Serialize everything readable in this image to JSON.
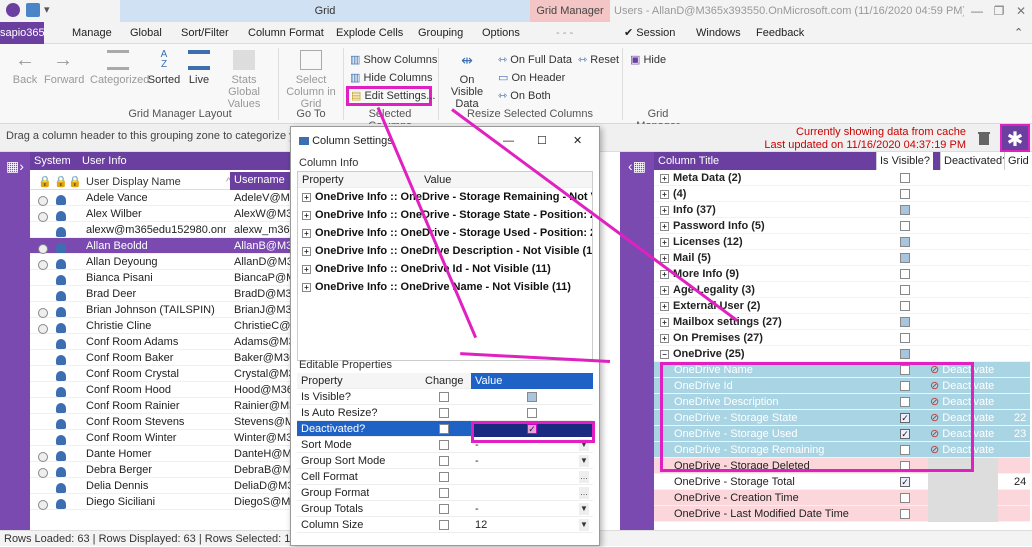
{
  "window": {
    "grid_title": "Grid",
    "gm_title": "Grid Manager",
    "title": "Users - AllanD@M365x393550.OnMicrosoft.com (11/16/2020 04:59 PM) - Adv...",
    "min": "—",
    "restore": "❐",
    "close": "✕"
  },
  "menu": {
    "app": "sapio365",
    "items": [
      "Manage",
      "Global",
      "Sort/Filter",
      "Column Format",
      "Explode Cells",
      "Grouping",
      "Options",
      "- - -",
      "Session",
      "Windows",
      "Feedback"
    ]
  },
  "ribbon": {
    "back": "Back",
    "forward": "Forward",
    "categorized": "Categorized",
    "sorted": "Sorted",
    "live": "Live",
    "stats": "Stats Global Values",
    "group_layout": "Grid Manager Layout",
    "select_col": "Select Column in Grid",
    "goto": "Go To",
    "show_cols": "Show Columns",
    "hide_cols": "Hide Columns",
    "edit_settings": "Edit Settings...",
    "group_selected": "Selected Columns",
    "on_visible": "On Visible Data",
    "on_full": "On Full Data",
    "on_header": "On Header",
    "on_both": "On Both",
    "reset": "Reset",
    "group_resize": "Resize Selected Columns",
    "hide": "Hide",
    "group_gm": "Grid Manager"
  },
  "groupzone": {
    "text": "Drag a column header to this grouping zone to categorize your gri",
    "cache1": "Currently showing data from cache",
    "cache2": "Last updated on 11/16/2020 04:37:19 PM"
  },
  "left": {
    "h_system": "System",
    "h_userinfo": "User Info",
    "c_name": "User Display Name",
    "c_user": "Username",
    "rows": [
      {
        "name": "Adele Vance",
        "user": "AdeleV@M365",
        "r": true
      },
      {
        "name": "Alex Wilber",
        "user": "AlexW@M365:",
        "r": true
      },
      {
        "name": "alexw@m365edu152980.onmicrc",
        "user": "alexw_m365ed",
        "r": false
      },
      {
        "name": "Allan Beoldd",
        "user": "AllanB@M365:",
        "r": true,
        "sel": true
      },
      {
        "name": "Allan Deyoung",
        "user": "AllanD@M365:",
        "r": true
      },
      {
        "name": "Bianca Pisani",
        "user": "BiancaP@M365",
        "r": false
      },
      {
        "name": "Brad Deer",
        "user": "BradD@M365x",
        "r": false
      },
      {
        "name": "Brian Johnson (TAILSPIN)",
        "user": "BrianJ@M365x",
        "r": true
      },
      {
        "name": "Christie Cline",
        "user": "ChristieC@M3",
        "r": true
      },
      {
        "name": "Conf Room Adams",
        "user": "Adams@M365",
        "r": false
      },
      {
        "name": "Conf Room Baker",
        "user": "Baker@M365x",
        "r": false
      },
      {
        "name": "Conf Room Crystal",
        "user": "Crystal@M365",
        "r": false
      },
      {
        "name": "Conf Room Hood",
        "user": "Hood@M365x",
        "r": false
      },
      {
        "name": "Conf Room Rainier",
        "user": "Rainier@M365",
        "r": false
      },
      {
        "name": "Conf Room Stevens",
        "user": "Stevens@M36",
        "r": false
      },
      {
        "name": "Conf Room Winter",
        "user": "Winter@M365",
        "r": false
      },
      {
        "name": "Dante Homer",
        "user": "DanteH@M365",
        "r": true
      },
      {
        "name": "Debra Berger",
        "user": "DebraB@M365",
        "r": true
      },
      {
        "name": "Delia Dennis",
        "user": "DeliaD@M365",
        "r": false
      },
      {
        "name": "Diego Siciliani",
        "user": "DiegoS@M365",
        "r": true
      }
    ]
  },
  "right": {
    "h_title": "Column Title",
    "h_vis": "Is Visible?",
    "h_deact": "Deactivated?",
    "h_grid": "Grid ...",
    "rows": [
      {
        "t": "Meta Data (2)",
        "type": "grp",
        "v": false
      },
      {
        "t": "(4)",
        "type": "grp",
        "v": false
      },
      {
        "t": "Info (37)",
        "type": "grp",
        "v": "part"
      },
      {
        "t": "Password Info (5)",
        "type": "grp",
        "v": false
      },
      {
        "t": "Licenses (12)",
        "type": "grp",
        "v": "part"
      },
      {
        "t": "Mail (5)",
        "type": "grp",
        "v": "part"
      },
      {
        "t": "More Info (9)",
        "type": "grp",
        "v": false
      },
      {
        "t": "Age Legality (3)",
        "type": "grp",
        "v": false
      },
      {
        "t": "External User (2)",
        "type": "grp",
        "v": false
      },
      {
        "t": "Mailbox settings (27)",
        "type": "grp",
        "v": "part"
      },
      {
        "t": "On Premises (27)",
        "type": "grp",
        "v": false
      },
      {
        "t": "OneDrive (25)",
        "type": "grpopen",
        "v": "part"
      },
      {
        "t": "OneDrive Name",
        "type": "hl",
        "v": false,
        "d": "Deactivate"
      },
      {
        "t": "OneDrive Id",
        "type": "hl",
        "v": false,
        "d": "Deactivate"
      },
      {
        "t": "OneDrive Description",
        "type": "hl",
        "v": false,
        "d": "Deactivate"
      },
      {
        "t": "OneDrive - Storage State",
        "type": "hl",
        "v": true,
        "d": "Deactivate",
        "g": "22"
      },
      {
        "t": "OneDrive - Storage Used",
        "type": "hl",
        "v": true,
        "d": "Deactivate",
        "g": "23"
      },
      {
        "t": "OneDrive - Storage Remaining",
        "type": "hl",
        "v": false,
        "d": "Deactivate"
      },
      {
        "t": "OneDrive - Storage Deleted",
        "type": "pink",
        "v": false
      },
      {
        "t": "OneDrive - Storage Total",
        "type": "gray",
        "v": true,
        "g": "24"
      },
      {
        "t": "OneDrive - Creation Time",
        "type": "pink",
        "v": false
      },
      {
        "t": "OneDrive - Last Modified Date Time",
        "type": "pink",
        "v": false
      }
    ]
  },
  "dialog": {
    "title": "Column Settings",
    "min": "—",
    "max": "☐",
    "close": "✕",
    "info_label": "Column Info",
    "p_prop": "Property",
    "p_val": "Value",
    "info": [
      "OneDrive Info :: OneDrive - Storage Remaining - Not V",
      "OneDrive Info :: OneDrive - Storage State - Position: 22",
      "OneDrive Info :: OneDrive - Storage Used - Position: 23",
      "OneDrive Info :: OneDrive Description - Not Visible (11",
      "OneDrive Info :: OneDrive Id - Not Visible (11)",
      "OneDrive Info :: OneDrive Name - Not Visible (11)"
    ],
    "edit_label": "Editable Properties",
    "e_prop": "Property",
    "e_change": "Change",
    "e_val": "Value",
    "props": [
      {
        "p": "Is Visible?",
        "v": "",
        "k": "chk"
      },
      {
        "p": "Is Auto Resize?",
        "v": "",
        "k": "chk"
      },
      {
        "p": "Deactivated?",
        "v": "",
        "k": "chk",
        "sel": true
      },
      {
        "p": "Sort Mode",
        "v": "-",
        "k": "dd"
      },
      {
        "p": "Group Sort Mode",
        "v": "-",
        "k": "dd"
      },
      {
        "p": "Cell Format",
        "v": "",
        "k": "dots"
      },
      {
        "p": "Group Format",
        "v": "",
        "k": "dots"
      },
      {
        "p": "Group Totals",
        "v": "-",
        "k": "dd"
      },
      {
        "p": "Column Size",
        "v": "12",
        "k": "dd"
      }
    ]
  },
  "status": "Rows Loaded: 63  |  Rows Displayed: 63  |  Rows Selected: 1",
  "colors": {
    "purple": "#6b3fa0",
    "magenta": "#e020c0",
    "highlight": "#a9d4e4",
    "select_blue": "#1f62c5"
  }
}
